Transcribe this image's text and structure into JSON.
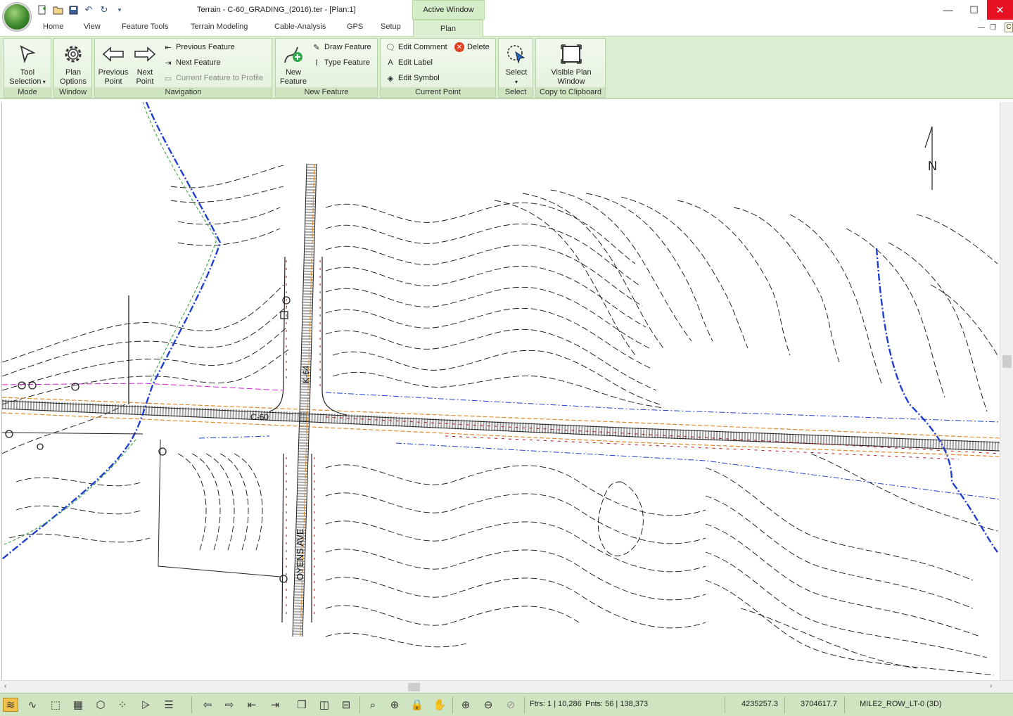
{
  "window": {
    "title": "Terrain - C-60_GRADING_(2016).ter - [Plan:1]",
    "active_window_label": "Active Window",
    "minimize_icon": "minimize-icon",
    "maximize_icon": "maximize-icon",
    "close_icon": "close-icon",
    "tooltip_stub": "C"
  },
  "tabs": [
    "Home",
    "View",
    "Feature Tools",
    "Terrain Modeling",
    "Cable-Analysis",
    "GPS",
    "Setup",
    "Plan"
  ],
  "active_tab": "Plan",
  "ribbon": {
    "mode": {
      "label": "Mode",
      "tool_selection": "Tool Selection",
      "tool_selection_line1": "Tool",
      "tool_selection_line2": "Selection"
    },
    "window": {
      "label": "Window",
      "plan_options_line1": "Plan",
      "plan_options_line2": "Options"
    },
    "navigation": {
      "label": "Navigation",
      "previous_point_line1": "Previous",
      "previous_point_line2": "Point",
      "next_point_line1": "Next",
      "next_point_line2": "Point",
      "previous_feature": "Previous Feature",
      "next_feature": "Next Feature",
      "current_feature_to_profile": "Current Feature to Profile"
    },
    "new_feature": {
      "label": "New Feature",
      "new_feature_line1": "New",
      "new_feature_line2": "Feature",
      "draw_feature": "Draw Feature",
      "type_feature": "Type Feature"
    },
    "current_point": {
      "label": "Current Point",
      "edit_comment": "Edit Comment",
      "delete": "Delete",
      "edit_label": "Edit Label",
      "edit_symbol": "Edit Symbol"
    },
    "select": {
      "label": "Select",
      "select_button": "Select"
    },
    "copy_to_clipboard": {
      "label": "Copy to Clipboard",
      "visible_plan_line1": "Visible Plan",
      "visible_plan_line2": "Window"
    }
  },
  "map": {
    "north_label": "N",
    "road_c60": "C-60",
    "road_k64": "K-64",
    "road_oyens": "OYENS AVE"
  },
  "status": {
    "features": "Ftrs: 1 | 10,286",
    "points": "Pnts: 56 | 138,373",
    "northing": "4235257.3",
    "easting": "3704617.7",
    "feature_name": "MILE2_ROW_LT-0 (3D)"
  },
  "colors": {
    "ribbon_bg": "#dceed2",
    "active_tab": "#dbeecf",
    "close_red": "#e81123",
    "ditch_blue": "#1f3fd0",
    "row_magenta": "#d020d0",
    "breakline_red": "#b01818",
    "edge_orange": "#e08a2a"
  }
}
